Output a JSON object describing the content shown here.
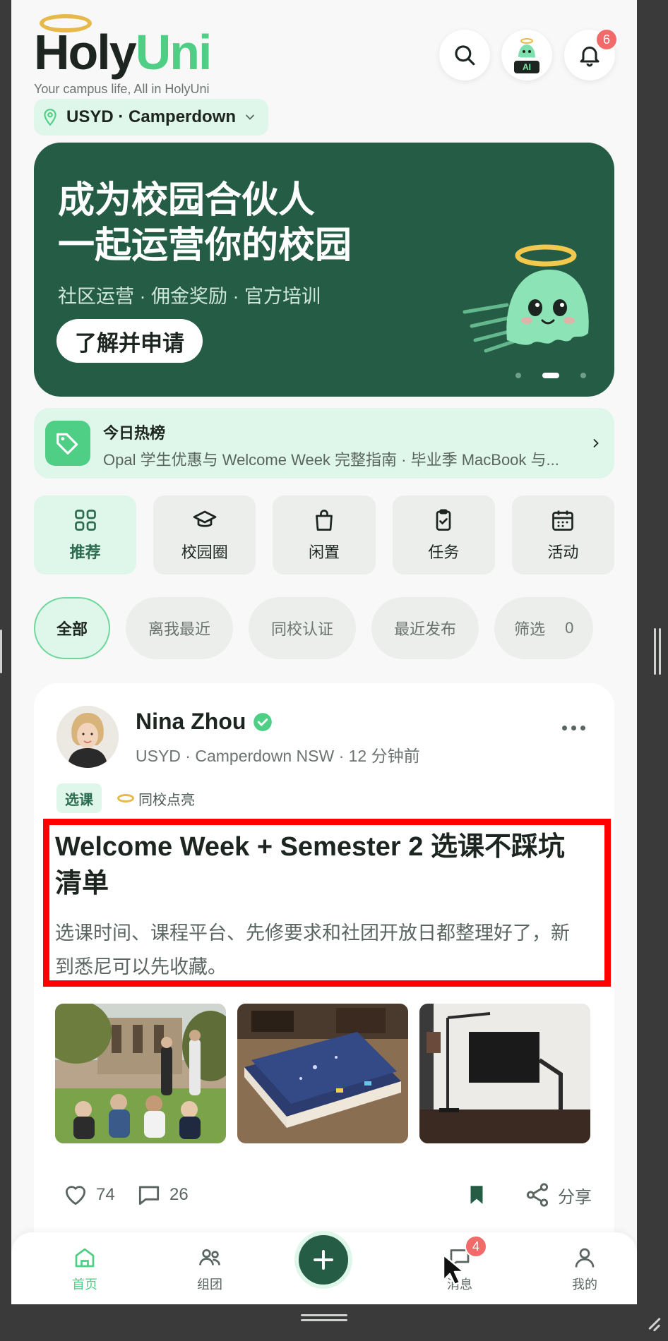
{
  "header": {
    "brand_holy": "Holy",
    "brand_uni": "Uni",
    "tagline": "Your campus life, All in HolyUni",
    "campus": "USYD · Camperdown",
    "ai_label": "AI",
    "notification_count": "6",
    "colors": {
      "brand_dark": "#1d2520",
      "brand_green": "#4fcf86",
      "halo_gold": "#e7b84a"
    }
  },
  "banner": {
    "title_line1": "成为校园合伙人",
    "title_line2": "一起运营你的校园",
    "subtitle": "社区运营 · 佣金奖励 · 官方培训",
    "cta": "了解并申请",
    "background": "#255c45"
  },
  "hot_list": {
    "title": "今日热榜",
    "description": "Opal 学生优惠与 Welcome Week 完整指南 · 毕业季 MacBook 与..."
  },
  "categories": [
    {
      "label": "推荐",
      "icon": "grid-icon"
    },
    {
      "label": "校园圈",
      "icon": "graduation-cap-icon"
    },
    {
      "label": "闲置",
      "icon": "shopping-bag-icon"
    },
    {
      "label": "任务",
      "icon": "clipboard-check-icon"
    },
    {
      "label": "活动",
      "icon": "calendar-icon"
    }
  ],
  "filters": [
    {
      "label": "全部"
    },
    {
      "label": "离我最近"
    },
    {
      "label": "同校认证"
    },
    {
      "label": "最近发布"
    },
    {
      "label": "筛选",
      "count": "0"
    }
  ],
  "post": {
    "author": "Nina Zhou",
    "meta": "USYD · Camperdown NSW · 12 分钟前",
    "tag": "选课",
    "badge": "同校点亮",
    "title": "Welcome Week + Semester 2 选课不踩坑清单",
    "body": "选课时间、课程平台、先修要求和社团开放日都整理好了，新到悉尼可以先收藏。",
    "likes": "74",
    "comments": "26",
    "share": "分享"
  },
  "tabbar": {
    "home": "首页",
    "groups": "组团",
    "messages": "消息",
    "messages_badge": "4",
    "me": "我的"
  }
}
